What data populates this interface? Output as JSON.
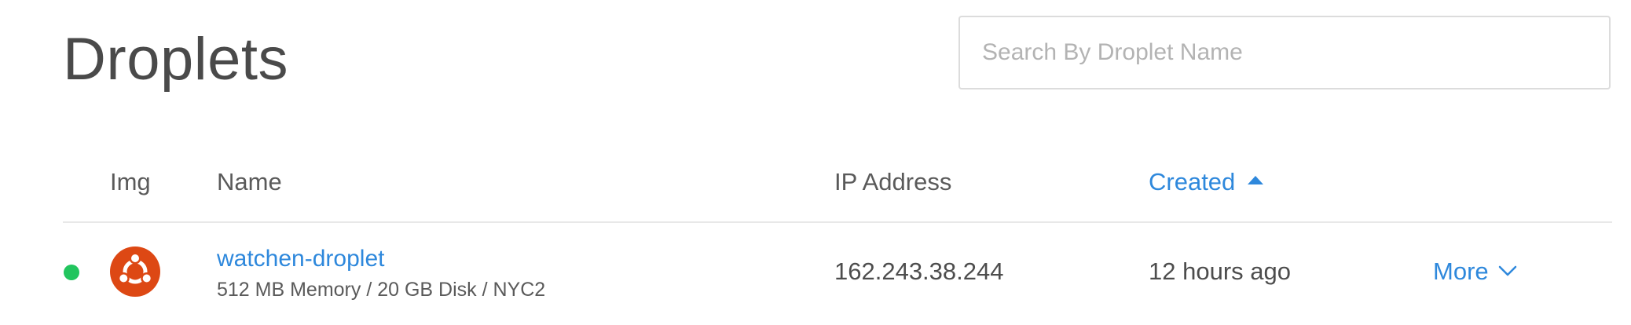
{
  "page": {
    "title": "Droplets"
  },
  "search": {
    "placeholder": "Search By Droplet Name",
    "value": ""
  },
  "table": {
    "columns": {
      "img": "Img",
      "name": "Name",
      "ip": "IP Address",
      "created": "Created"
    },
    "sort": {
      "column": "created",
      "direction": "ascending"
    },
    "rows": [
      {
        "status": "active",
        "status_color": "#22c55e",
        "image_icon": "ubuntu-icon",
        "name": "watchen-droplet",
        "meta": "512 MB Memory / 20 GB Disk / NYC2",
        "ip": "162.243.38.244",
        "created": "12 hours ago",
        "more_label": "More"
      }
    ]
  },
  "colors": {
    "accent": "#2e88dc",
    "ubuntu": "#dd4814",
    "text": "#4d4d4d"
  }
}
